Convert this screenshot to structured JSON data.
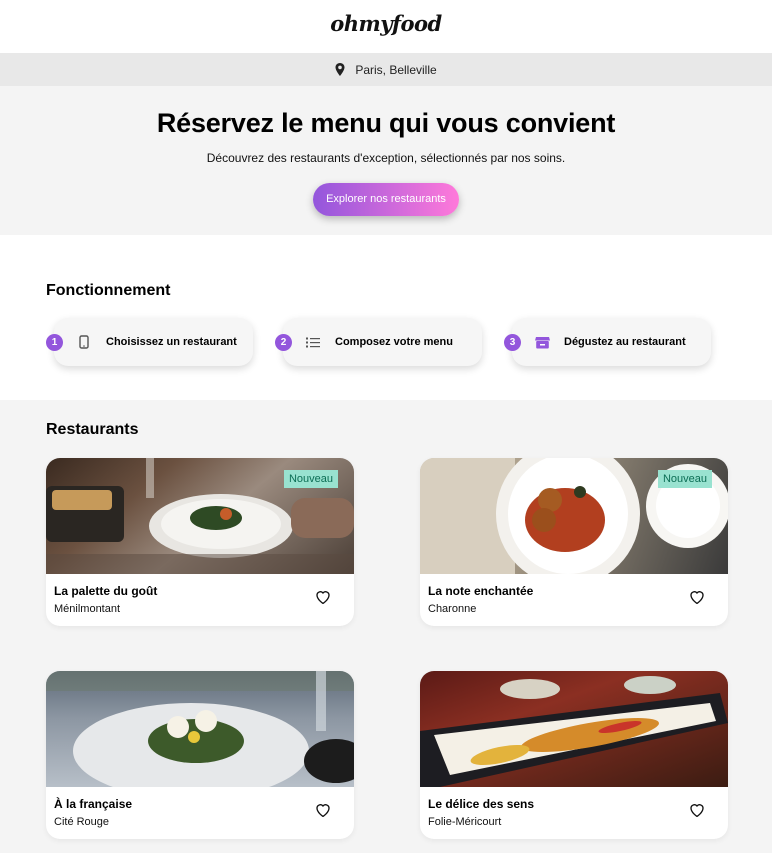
{
  "brand": {
    "logo": "ohmyfood"
  },
  "location": {
    "icon": "map-pin-icon",
    "label": "Paris, Belleville"
  },
  "hero": {
    "title": "Réservez le menu qui vous convient",
    "subtitle": "Découvrez des restaurants d'exception, sélectionnés par nos soins.",
    "cta_label": "Explorer nos restaurants"
  },
  "how": {
    "title": "Fonctionnement",
    "steps": [
      {
        "number": "1",
        "icon": "phone-icon",
        "label": "Choisissez un restaurant"
      },
      {
        "number": "2",
        "icon": "list-icon",
        "label": "Composez votre menu"
      },
      {
        "number": "3",
        "icon": "store-icon",
        "label": "Dégustez au restaurant"
      }
    ]
  },
  "restaurants": {
    "title": "Restaurants",
    "items": [
      {
        "name": "La palette du goût",
        "district": "Ménilmontant",
        "badge": "Nouveau"
      },
      {
        "name": "La note enchantée",
        "district": "Charonne",
        "badge": "Nouveau"
      },
      {
        "name": "À la française",
        "district": "Cité Rouge",
        "badge": ""
      },
      {
        "name": "Le délice des sens",
        "district": "Folie-Méricourt",
        "badge": ""
      }
    ]
  },
  "colors": {
    "accent": "#9356dc",
    "accent_light": "#ff79da",
    "badge_bg": "#99e2d0",
    "badge_text": "#0c6e55"
  }
}
